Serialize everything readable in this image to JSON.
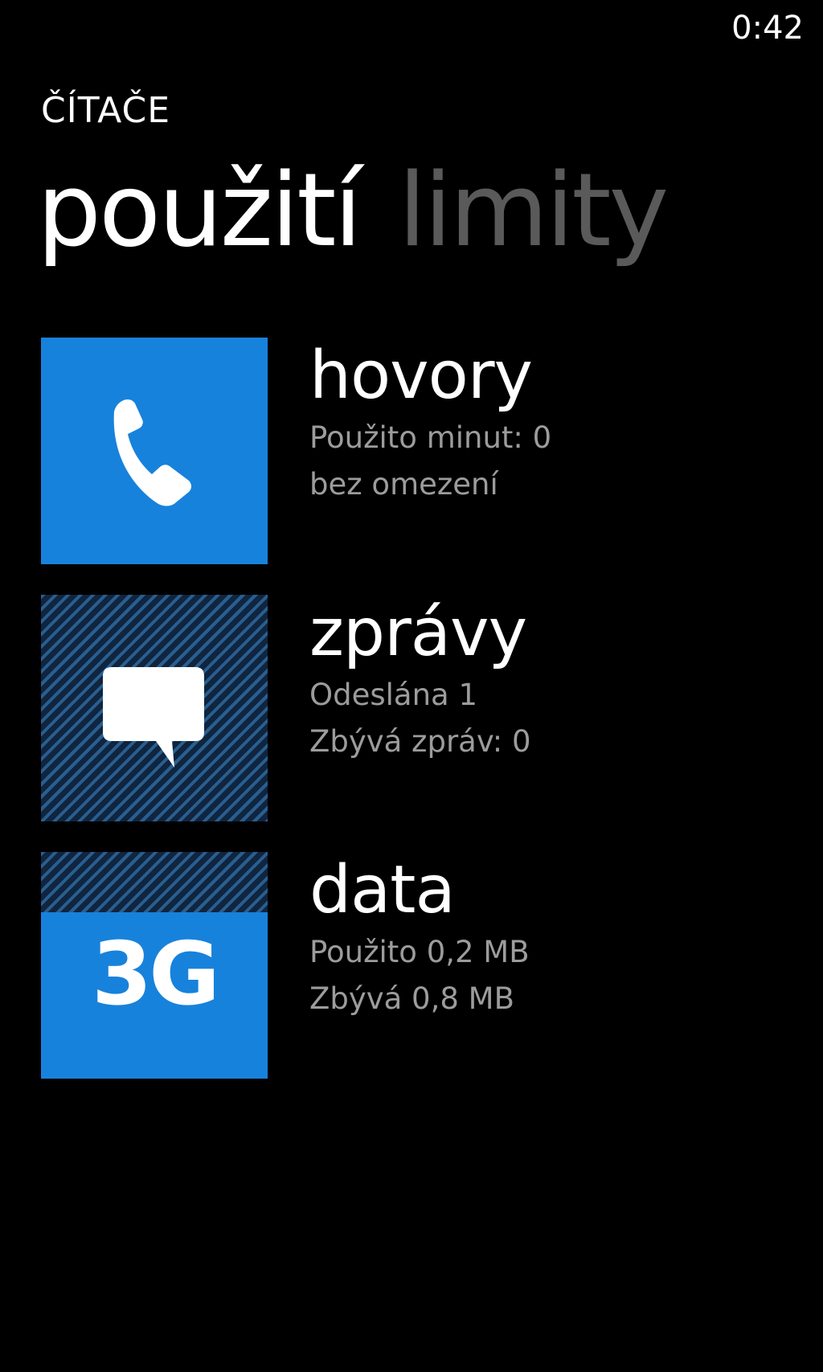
{
  "status_bar": {
    "time": "0:42"
  },
  "app": {
    "title": "ČÍTAČE"
  },
  "pivot": {
    "active": "použití",
    "inactive": "limity"
  },
  "counters": [
    {
      "title": "hovory",
      "line1": "Použito minut: 0",
      "line2": "bez omezení",
      "icon": "phone-icon"
    },
    {
      "title": "zprávy",
      "line1": "Odeslána 1",
      "line2": "Zbývá zpráv: 0",
      "icon": "message-icon"
    },
    {
      "title": "data",
      "line1": "Použito 0,2 MB",
      "line2": "Zbývá 0,8 MB",
      "icon": "data-3g-icon",
      "tile_label": "3G",
      "used_fraction": 0.2
    }
  ],
  "colors": {
    "accent": "#1782dc",
    "background": "#000000",
    "secondary_text": "#9c9c9c",
    "inactive_pivot": "#5a5a5a"
  }
}
